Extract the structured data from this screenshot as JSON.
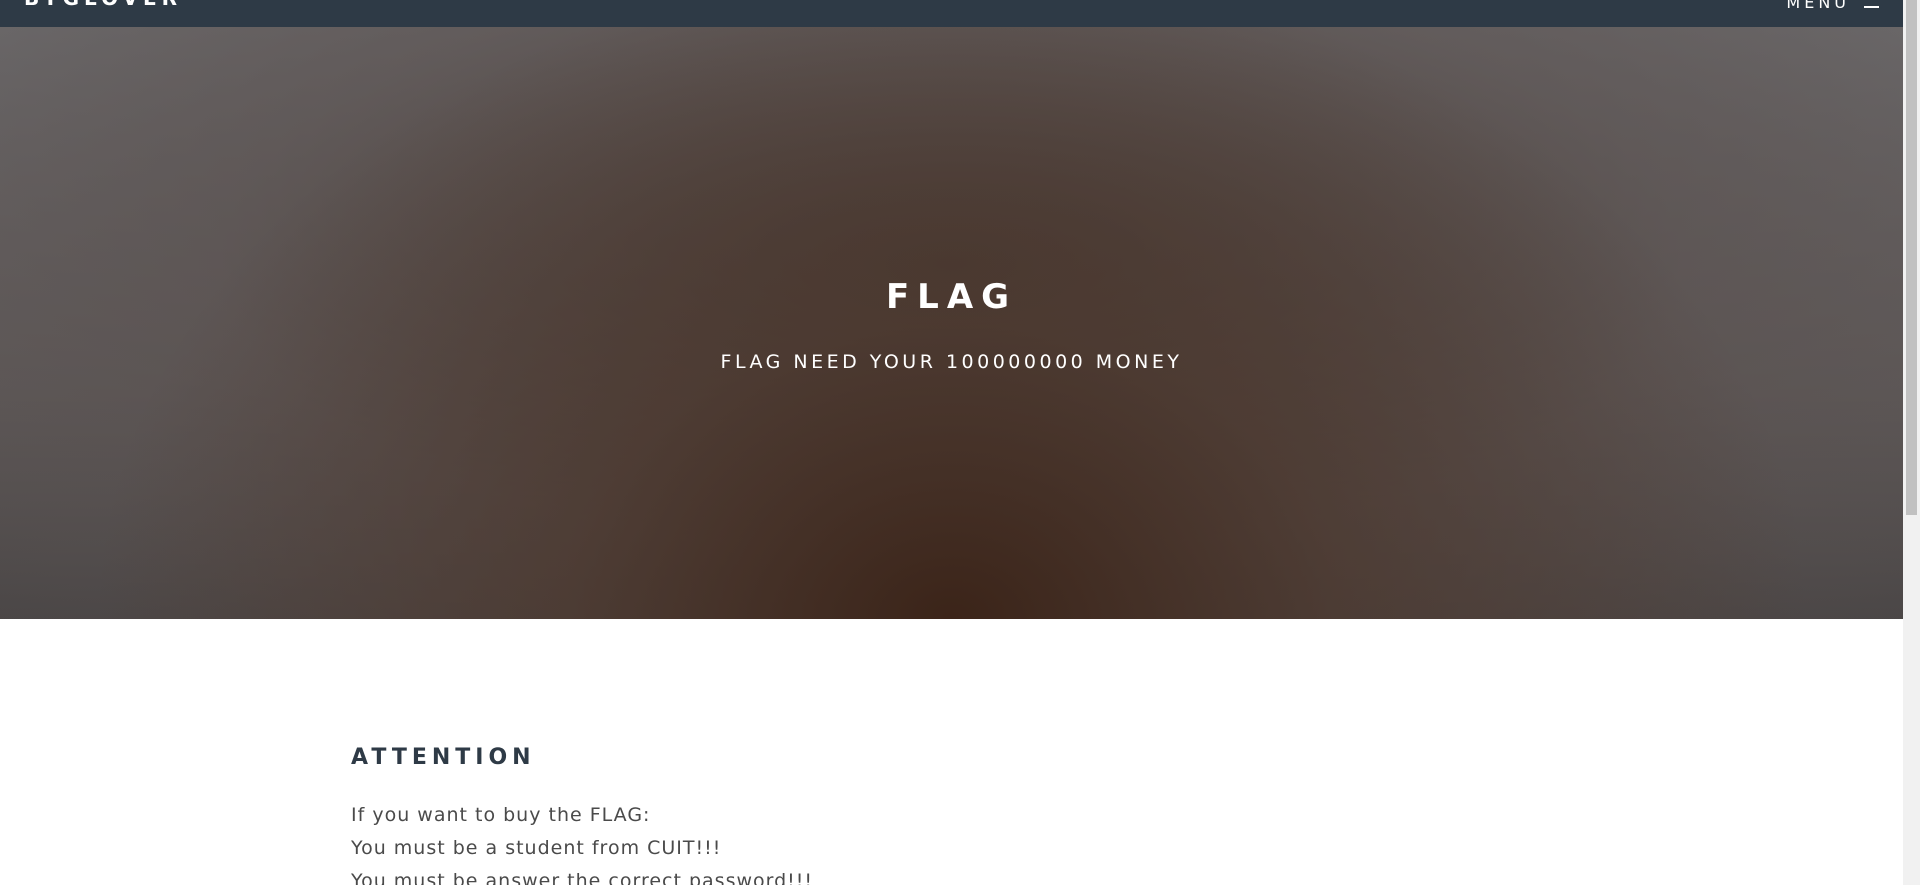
{
  "nav": {
    "brand": "BYGLOVER",
    "menu_label": "MENU",
    "menu_icon": "hamburger-icon"
  },
  "hero": {
    "title": "FLAG",
    "subtitle": "FLAG NEED YOUR 100000000 MONEY"
  },
  "attention": {
    "title": "ATTENTION",
    "lines": [
      "If you want to buy the FLAG:",
      "You must be a student from CUIT!!!",
      "You must be answer the correct password!!!"
    ]
  }
}
